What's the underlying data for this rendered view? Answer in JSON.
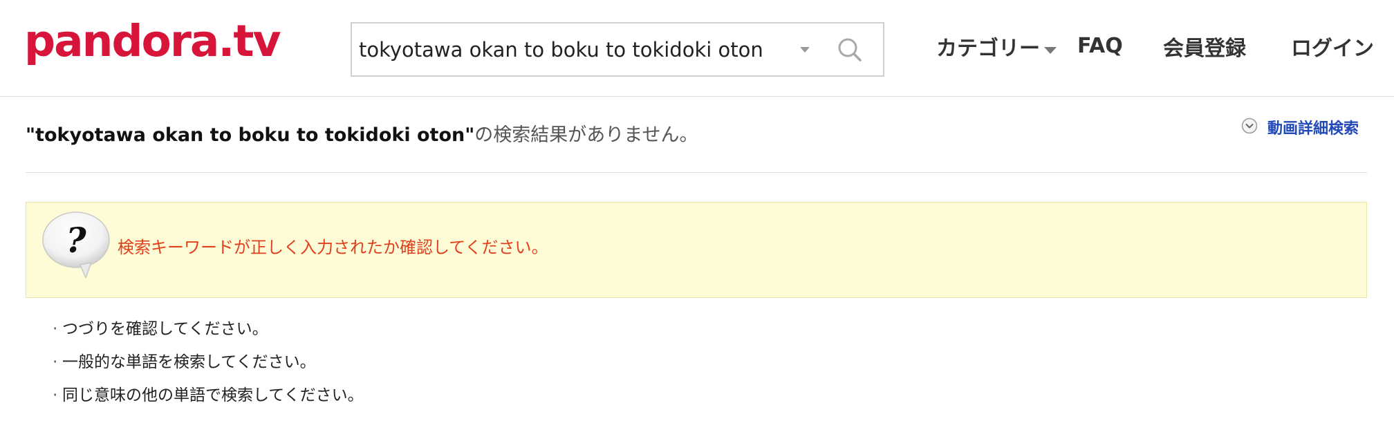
{
  "header": {
    "logo": "pandora.tv",
    "search": {
      "value": "tokyotawa okan to boku to tokidoki oton",
      "placeholder": ""
    },
    "nav": {
      "category": "カテゴリー",
      "faq": "FAQ",
      "register": "会員登録",
      "login": "ログイン"
    }
  },
  "results": {
    "keyword": "\"tokyotawa okan to boku to tokidoki oton\"",
    "no_result_message": "の検索結果がありません。",
    "advanced_search": "動画詳細検索"
  },
  "notice": {
    "text": "検索キーワードが正しく入力されたか確認してください。"
  },
  "tips": [
    "つづりを確認してください。",
    "一般的な単語を検索してください。",
    "同じ意味の他の単語で検索してください。"
  ],
  "colors": {
    "brand": "#d7153a",
    "link": "#2249b8",
    "notice_text": "#e0401c",
    "notice_bg": "#fefbd7"
  },
  "icons": {
    "search": "search-icon",
    "chevron": "chevron-down-icon",
    "question": "question-bubble-icon"
  }
}
